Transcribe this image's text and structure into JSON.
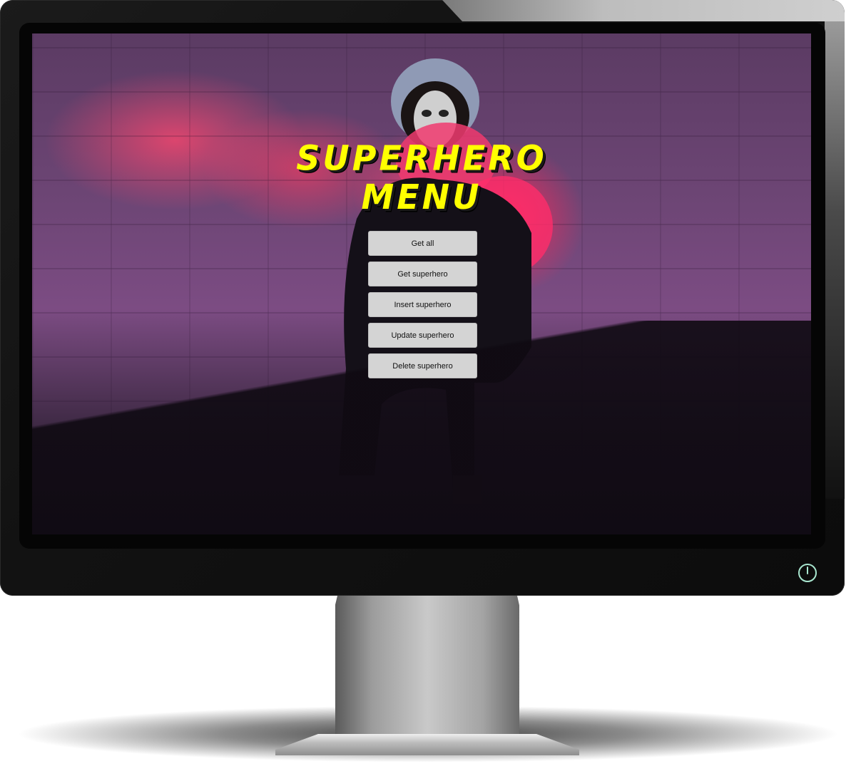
{
  "app": {
    "title_line1": "SUPERHERO",
    "title_line2": "MENU"
  },
  "menu": {
    "buttons": [
      {
        "label": "Get all"
      },
      {
        "label": "Get superhero"
      },
      {
        "label": "Insert superhero"
      },
      {
        "label": "Update superhero"
      },
      {
        "label": "Delete superhero"
      }
    ]
  },
  "colors": {
    "title": "#ffff00",
    "button_bg": "#d4d4d4",
    "button_text": "#111111",
    "power_icon": "#a8e6cf"
  },
  "icons": {
    "power": "power-icon"
  }
}
